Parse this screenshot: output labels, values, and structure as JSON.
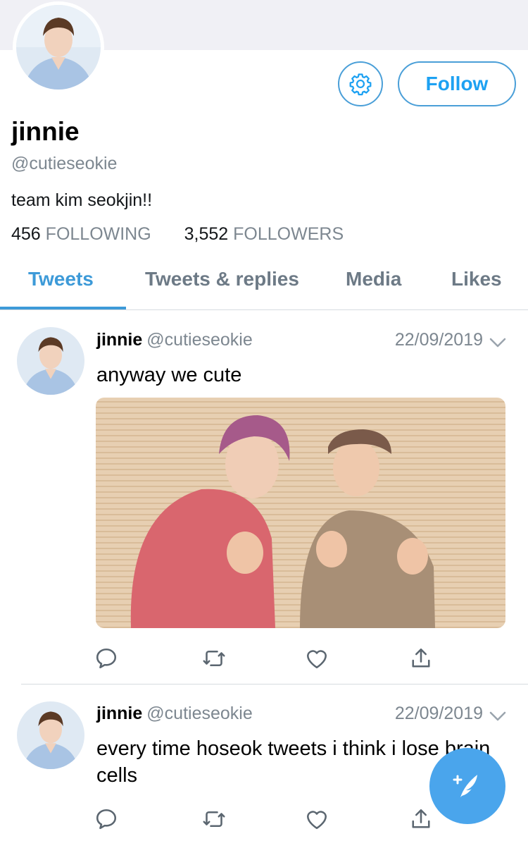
{
  "profile": {
    "display_name": "jinnie",
    "handle": "@cutieseokie",
    "bio": "team kim seokjin!!",
    "following_count": "456",
    "following_label": "FOLLOWING",
    "followers_count": "3,552",
    "followers_label": "FOLLOWERS",
    "follow_button_label": "Follow",
    "settings_icon": "gear-icon"
  },
  "tabs": [
    {
      "label": "Tweets",
      "active": true
    },
    {
      "label": "Tweets & replies",
      "active": false
    },
    {
      "label": "Media",
      "active": false
    },
    {
      "label": "Likes",
      "active": false
    }
  ],
  "tweets": [
    {
      "name": "jinnie",
      "handle": "@cutieseokie",
      "date": "22/09/2019",
      "text": "anyway we cute",
      "has_media": true
    },
    {
      "name": "jinnie",
      "handle": "@cutieseokie",
      "date": "22/09/2019",
      "text": "every time hoseok tweets i think i lose brain cells",
      "has_media": false
    }
  ],
  "icons": {
    "reply": "reply-icon",
    "retweet": "retweet-icon",
    "like": "heart-icon",
    "share": "share-icon",
    "compose": "compose-icon"
  },
  "colors": {
    "accent": "#1da1f2",
    "secondary_text": "#7d8790",
    "divider": "#d6dbe0"
  }
}
